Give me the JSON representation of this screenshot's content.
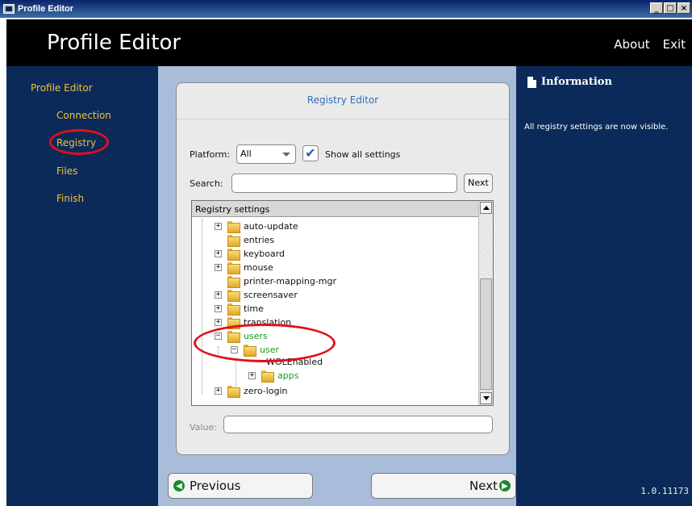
{
  "window": {
    "title": "Profile Editor",
    "min_label": "_",
    "max_label": "□",
    "close_label": "×"
  },
  "header": {
    "title": "Profile Editor",
    "about_label": "About",
    "exit_label": "Exit"
  },
  "sidebar": {
    "items": [
      {
        "label": "Profile Editor"
      },
      {
        "label": "Connection"
      },
      {
        "label": "Registry"
      },
      {
        "label": "Files"
      },
      {
        "label": "Finish"
      }
    ]
  },
  "editor": {
    "title": "Registry Editor",
    "platform_label": "Platform:",
    "platform_value": "All",
    "show_all_label": "Show all settings",
    "show_all_checked": true,
    "search_label": "Search:",
    "search_value": "",
    "next_label": "Next",
    "tree_header": "Registry settings",
    "tree": [
      {
        "label": "auto-update",
        "expandable": true,
        "level": 1
      },
      {
        "label": "entries",
        "expandable": false,
        "level": 1
      },
      {
        "label": "keyboard",
        "expandable": true,
        "level": 1
      },
      {
        "label": "mouse",
        "expandable": true,
        "level": 1
      },
      {
        "label": "printer-mapping-mgr",
        "expandable": false,
        "level": 1
      },
      {
        "label": "screensaver",
        "expandable": true,
        "level": 1
      },
      {
        "label": "time",
        "expandable": true,
        "level": 1
      },
      {
        "label": "translation",
        "expandable": true,
        "level": 1
      },
      {
        "label": "users",
        "expandable": true,
        "expanded": true,
        "level": 1,
        "highlight": true
      },
      {
        "label": "user",
        "expandable": true,
        "expanded": true,
        "level": 2,
        "highlight": true
      },
      {
        "label": "WOLEnabled",
        "expandable": false,
        "level": 3
      },
      {
        "label": "apps",
        "expandable": true,
        "level": 3,
        "highlight": true
      },
      {
        "label": "zero-login",
        "expandable": true,
        "level": 1
      }
    ],
    "value_label": "Value:",
    "value": ""
  },
  "footer": {
    "previous_label": "Previous",
    "next_label": "Next"
  },
  "info": {
    "title": "Information",
    "text": "All registry settings are now visible.",
    "version": "1.0.11173"
  },
  "colors": {
    "highlight_green": "#1a9a1a",
    "annotation_red": "#e0101c",
    "nav_yellow": "#f1c232",
    "panel_blue": "#0b2a5a"
  }
}
